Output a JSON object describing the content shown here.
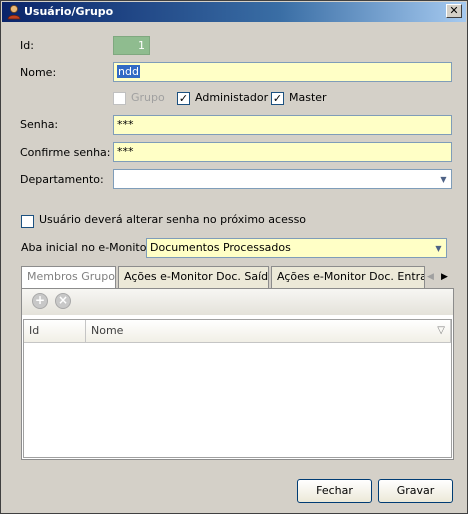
{
  "window": {
    "title": "Usuário/Grupo",
    "close_glyph": "✕"
  },
  "form": {
    "id_label": "Id:",
    "id_value": "1",
    "nome_label": "Nome:",
    "nome_value": "ndd",
    "grupo_label": "Grupo",
    "administrador_label": "Administador",
    "master_label": "Master",
    "senha_label": "Senha:",
    "senha_value": "***",
    "confirme_label": "Confirme senha:",
    "confirme_value": "***",
    "departamento_label": "Departamento:",
    "departamento_value": "",
    "alterar_senha_label": "Usuário deverá alterar senha no próximo acesso",
    "aba_label": "Aba inicial no e-Monitor:",
    "aba_value": "Documentos Processados"
  },
  "checks": {
    "grupo": false,
    "administrador": true,
    "master": true,
    "alterar_senha": false
  },
  "tabs": [
    {
      "label": "Membros Grupo",
      "active": true
    },
    {
      "label": "Ações e-Monitor Doc. Saída",
      "active": false
    },
    {
      "label": "Ações e-Monitor Doc. Entrada",
      "active": false
    }
  ],
  "grid": {
    "columns": [
      "Id",
      "Nome"
    ]
  },
  "buttons": {
    "fechar": "Fechar",
    "gravar": "Gravar"
  },
  "glyphs": {
    "check": "✓",
    "combo_arrow": "▼",
    "tab_prev": "◀",
    "tab_next": "▶",
    "add": "+",
    "remove": "×",
    "sort": "▽"
  }
}
